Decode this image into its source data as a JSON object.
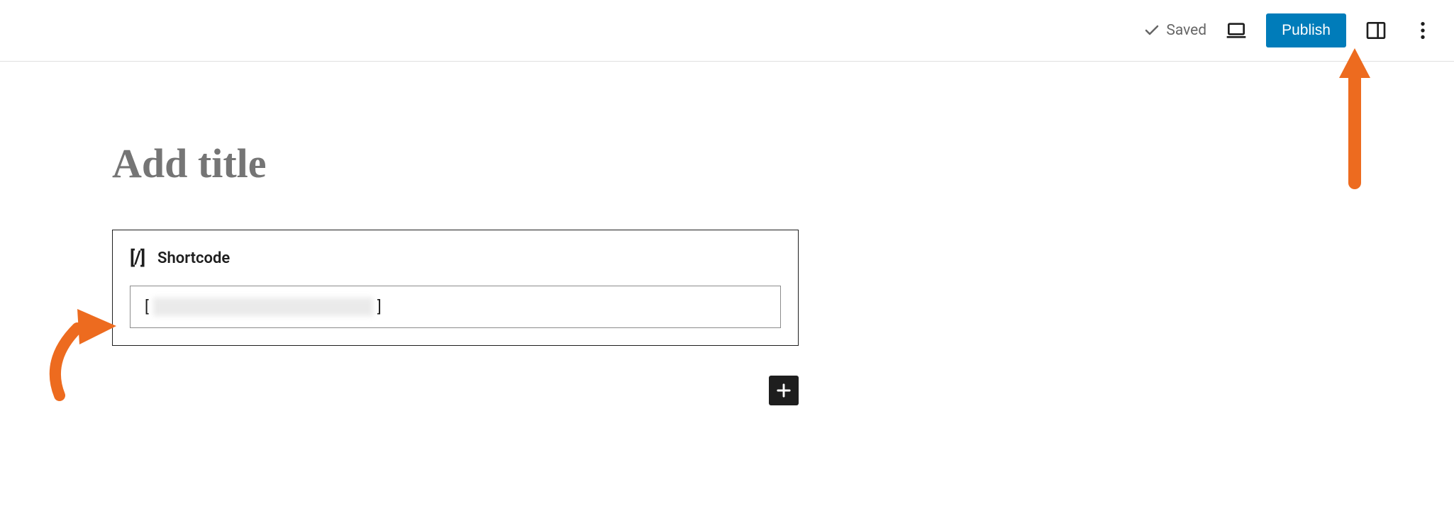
{
  "header": {
    "saved_label": "Saved",
    "publish_label": "Publish"
  },
  "editor": {
    "title_placeholder": "Add title",
    "shortcode": {
      "label": "Shortcode",
      "value_left": "[",
      "value_right": " ]"
    }
  }
}
